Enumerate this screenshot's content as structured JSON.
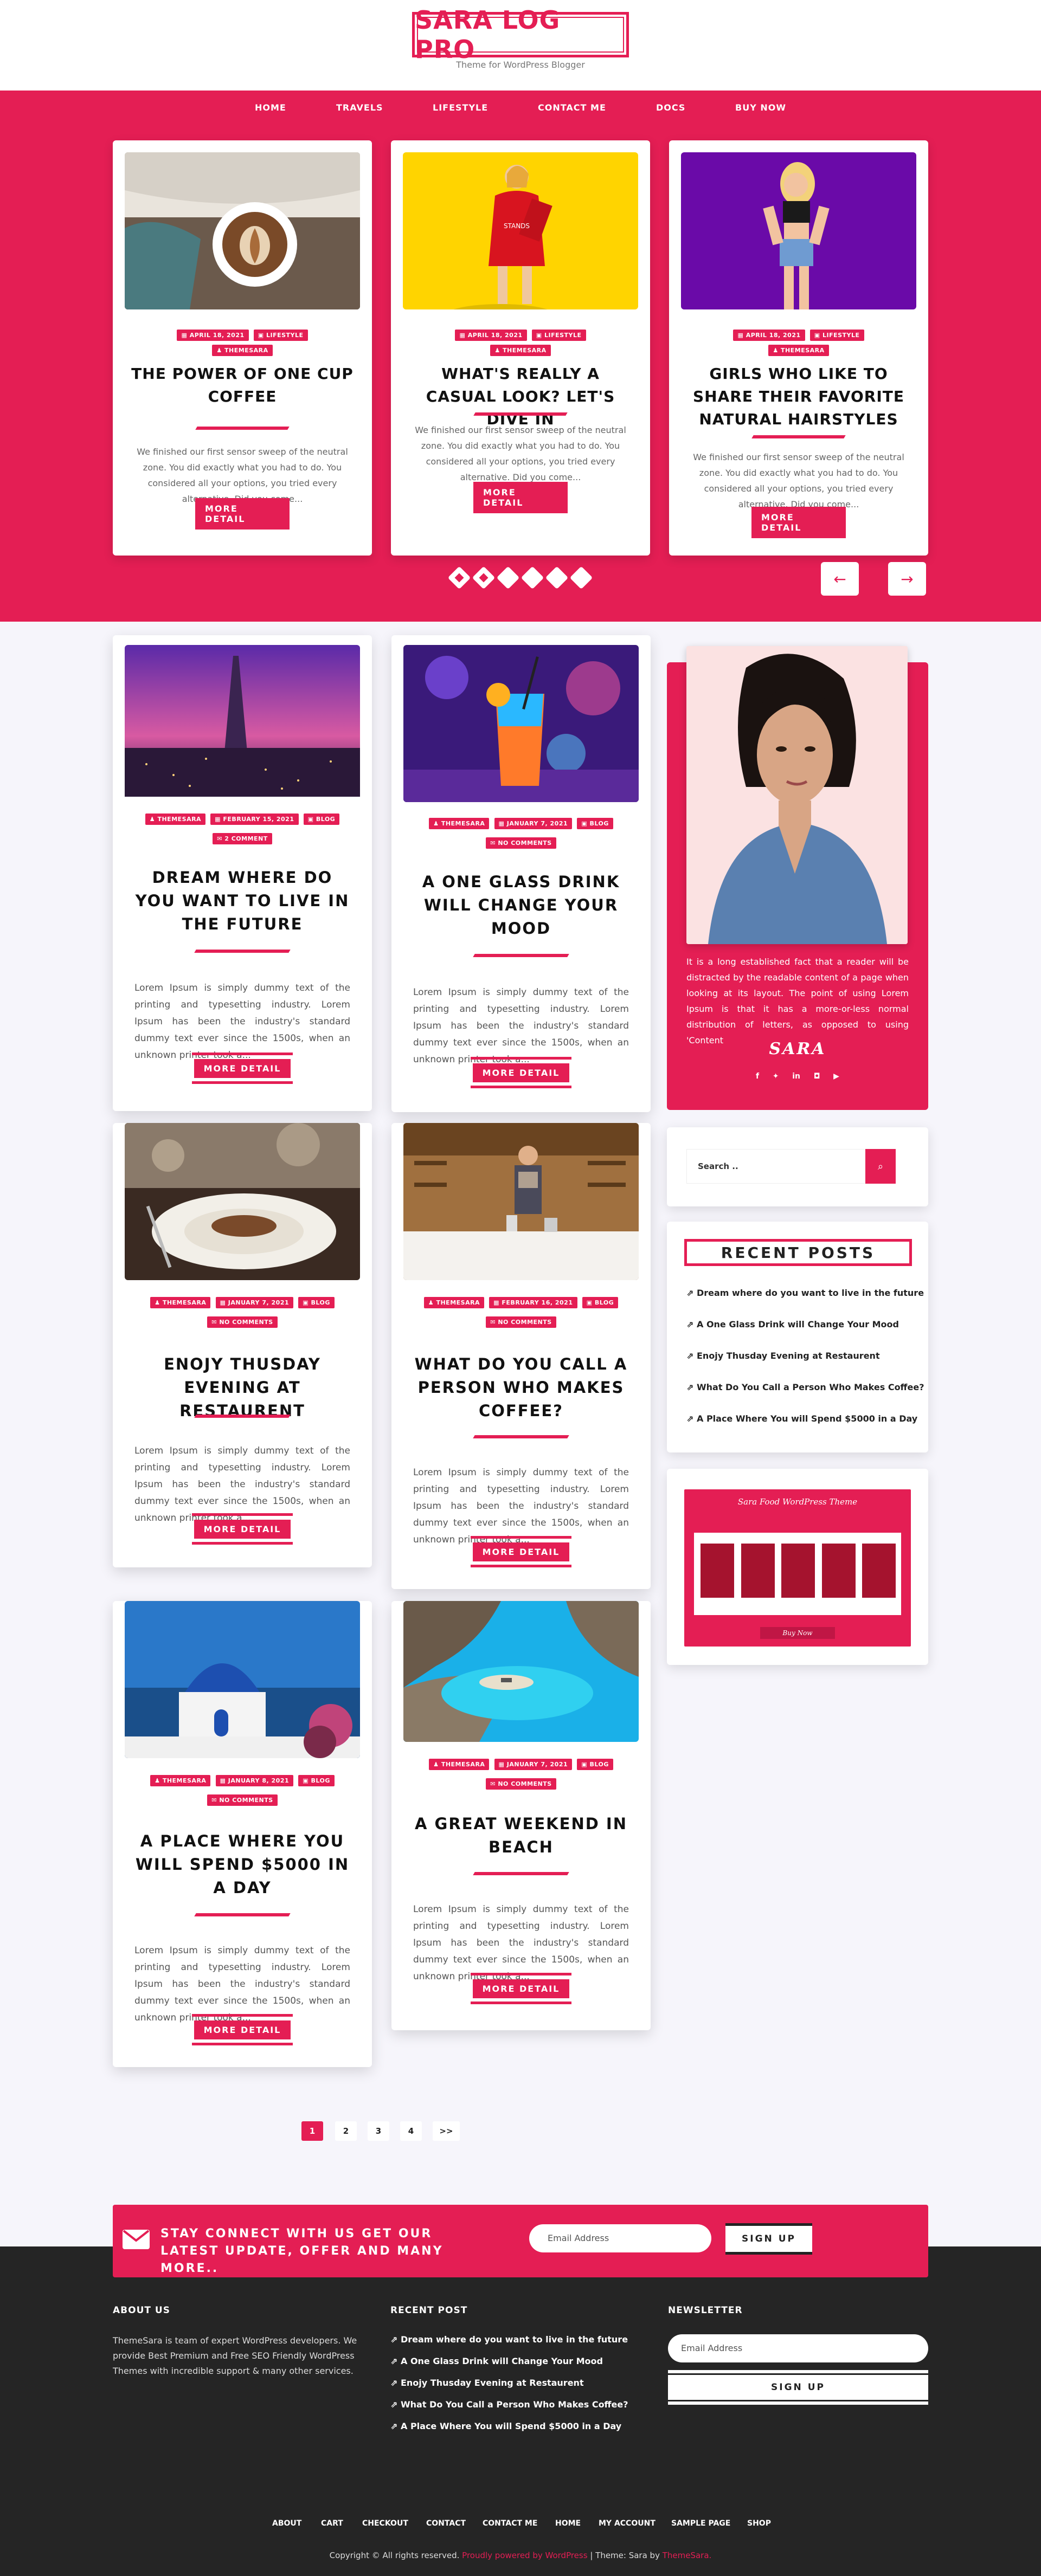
{
  "header": {
    "logo": "SARA LOG PRO",
    "tagline": "Theme for WordPress Blogger"
  },
  "nav": [
    "HOME",
    "TRAVELS",
    "LIFESTYLE",
    "CONTACT ME",
    "DOCS",
    "BUY NOW"
  ],
  "slider": {
    "slides": [
      {
        "date": "APRIL 18, 2021",
        "category": "LIFESTYLE",
        "author": "THEMESARA",
        "title": "THE POWER OF ONE CUP COFFEE",
        "excerpt": "We finished our first sensor sweep of the neutral zone. You did exactly what you had to do. You considered all your options, you tried every alternative. Did you come...",
        "button": "MORE DETAIL"
      },
      {
        "date": "APRIL 18, 2021",
        "category": "LIFESTYLE",
        "author": "THEMESARA",
        "title": "WHAT'S REALLY A CASUAL LOOK? LET'S DIVE IN",
        "excerpt": "We finished our first sensor sweep of the neutral zone. You did exactly what you had to do. You considered all your options, you tried every alternative. Did you come...",
        "button": "MORE DETAIL"
      },
      {
        "date": "APRIL 18, 2021",
        "category": "LIFESTYLE",
        "author": "THEMESARA",
        "title": "GIRLS WHO LIKE TO SHARE THEIR FAVORITE NATURAL HAIRSTYLES",
        "excerpt": "We finished our first sensor sweep of the neutral zone. You did exactly what you had to do. You considered all your options, you tried every alternative. Did you come...",
        "button": "MORE DETAIL"
      }
    ],
    "prev_arrow": "←",
    "next_arrow": "→"
  },
  "posts": [
    {
      "author": "THEMESARA",
      "date": "FEBRUARY 15, 2021",
      "category": "BLOG",
      "comments": "2 COMMENT",
      "title": "DREAM WHERE DO YOU WANT TO LIVE IN THE FUTURE",
      "excerpt": "Lorem Ipsum is simply dummy text of the printing and typesetting industry. Lorem Ipsum has been the industry's standard dummy text ever since the 1500s, when an unknown printer took a...",
      "button": "MORE DETAIL"
    },
    {
      "author": "THEMESARA",
      "date": "JANUARY 7, 2021",
      "category": "BLOG",
      "comments": "NO COMMENTS",
      "title": "A ONE GLASS DRINK WILL CHANGE YOUR MOOD",
      "excerpt": "Lorem Ipsum is simply dummy text of the printing and typesetting industry. Lorem Ipsum has been the industry's standard dummy text ever since the 1500s, when an unknown printer took a...",
      "button": "MORE DETAIL"
    },
    {
      "author": "THEMESARA",
      "date": "JANUARY 7, 2021",
      "category": "BLOG",
      "comments": "NO COMMENTS",
      "title": "ENOJY THUSDAY EVENING AT RESTAURENT",
      "excerpt": "Lorem Ipsum is simply dummy text of the printing and typesetting industry. Lorem Ipsum has been the industry's standard dummy text ever since the 1500s, when an unknown printer took a...",
      "button": "MORE DETAIL"
    },
    {
      "author": "THEMESARA",
      "date": "FEBRUARY 16, 2021",
      "category": "BLOG",
      "comments": "NO COMMENTS",
      "title": "WHAT DO YOU CALL A PERSON WHO MAKES COFFEE?",
      "excerpt": "Lorem Ipsum is simply dummy text of the printing and typesetting industry. Lorem Ipsum has been the industry's standard dummy text ever since the 1500s, when an unknown printer took a...",
      "button": "MORE DETAIL"
    },
    {
      "author": "THEMESARA",
      "date": "JANUARY 8, 2021",
      "category": "BLOG",
      "comments": "NO COMMENTS",
      "title": "A PLACE WHERE YOU WILL SPEND $5000 IN A DAY",
      "excerpt": "Lorem Ipsum is simply dummy text of the printing and typesetting industry. Lorem Ipsum has been the industry's standard dummy text ever since the 1500s, when an unknown printer took a...",
      "button": "MORE DETAIL"
    },
    {
      "author": "THEMESARA",
      "date": "JANUARY 7, 2021",
      "category": "BLOG",
      "comments": "NO COMMENTS",
      "title": "A GREAT WEEKEND IN BEACH",
      "excerpt": "Lorem Ipsum is simply dummy text of the printing and typesetting industry. Lorem Ipsum has been the industry's standard dummy text ever since the 1500s, when an unknown printer took a...",
      "button": "MORE DETAIL"
    }
  ],
  "sidebar": {
    "about_text": "It is a long established fact that a reader will be distracted by the readable content of a page when looking at its layout. The point of using Lorem Ipsum is that it has a more-or-less normal distribution of letters, as opposed to using 'Content",
    "signature": "SARA",
    "social_icons": [
      "facebook-icon",
      "twitter-icon",
      "linkedin-icon",
      "instagram-icon",
      "youtube-icon"
    ],
    "search_placeholder": "Search ..",
    "recent_title": "RECENT POSTS",
    "recent_posts": [
      "Dream where do you want to live in the future",
      "A One Glass Drink will Change Your Mood",
      "Enojy Thusday Evening at Restaurent",
      "What Do You Call a Person Who Makes Coffee?",
      "A Place Where You will Spend $5000 in a Day"
    ],
    "ad_title": "Sara Food WordPress Theme",
    "ad_button": "Buy Now"
  },
  "pagination": [
    "1",
    "2",
    "3",
    "4",
    ">>"
  ],
  "newsletter_band": {
    "text": "STAY CONNECT WITH US GET OUR LATEST UPDATE, OFFER AND MANY MORE..",
    "placeholder": "Email Address",
    "button": "SIGN UP"
  },
  "footer": {
    "about_title": "ABOUT US",
    "about_text": "ThemeSara is team of expert WordPress developers. We provide Best Premium and Free SEO Friendly WordPress Themes with incredible support & many other services.",
    "recent_title": "RECENT POST",
    "recent_posts": [
      "Dream where do you want to live in the future",
      "A One Glass Drink will Change Your Mood",
      "Enojy Thusday Evening at Restaurent",
      "What Do You Call a Person Who Makes Coffee?",
      "A Place Where You will Spend $5000 in a Day"
    ],
    "newsletter_title": "NEWSLETTER",
    "newsletter_placeholder": "Email Address",
    "newsletter_button": "SIGN UP",
    "bottom_links": [
      "ABOUT",
      "CART",
      "CHECKOUT",
      "CONTACT",
      "CONTACT ME",
      "HOME",
      "MY ACCOUNT",
      "SAMPLE PAGE",
      "SHOP"
    ],
    "copyright": "Copyright © All rights reserved.",
    "powered": "Proudly powered by WordPress",
    "theme_label": "| Theme: Sara by",
    "theme_link": "ThemeSara."
  }
}
